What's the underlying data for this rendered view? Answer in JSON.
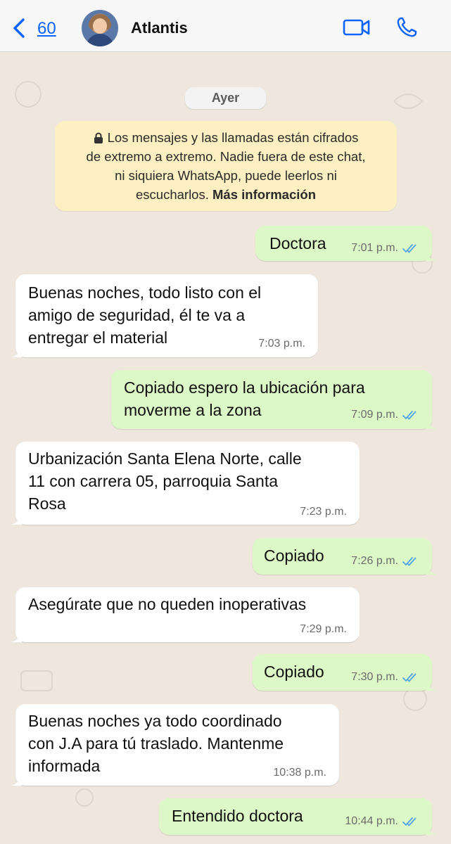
{
  "header": {
    "back_count": "60",
    "contact_name": "Atlantis",
    "icons": {
      "back": "chevron-left-icon",
      "video": "video-camera-icon",
      "phone": "phone-icon"
    },
    "accent_color": "#0a64ff"
  },
  "chat": {
    "date_chip": "Ayer",
    "encryption_notice": {
      "text": "Los mensajes y las llamadas están cifrados de extremo a extremo. Nadie fuera de este chat, ni siquiera WhatsApp, puede leerlos ni escucharlos.",
      "line1": "Los mensajes y las llamadas están cifrados",
      "line2": "de extremo a extremo. Nadie fuera de este chat,",
      "line3": "ni siquiera WhatsApp, puede leerlos ni",
      "line4_prefix": "escucharlos.",
      "link": "Más información"
    },
    "messages": [
      {
        "direction": "outgoing",
        "lines": [
          "Doctora"
        ],
        "time": "7:01 p.m.",
        "read": true
      },
      {
        "direction": "incoming",
        "lines": [
          "Buenas noches, todo listo con el",
          "amigo de seguridad, él te va a",
          "entregar el material"
        ],
        "time": "7:03 p.m."
      },
      {
        "direction": "outgoing",
        "lines": [
          "Copiado espero la ubicación para",
          "moverme a la zona"
        ],
        "time": "7:09 p.m.",
        "read": true
      },
      {
        "direction": "incoming",
        "lines": [
          "Urbanización Santa Elena Norte, calle",
          "11 con carrera 05, parroquia Santa",
          "Rosa"
        ],
        "time": "7:23 p.m."
      },
      {
        "direction": "outgoing",
        "lines": [
          "Copiado"
        ],
        "time": "7:26 p.m.",
        "read": true
      },
      {
        "direction": "incoming",
        "lines": [
          "Asegúrate que no queden inoperativas"
        ],
        "time": "7:29 p.m."
      },
      {
        "direction": "outgoing",
        "lines": [
          "Copiado"
        ],
        "time": "7:30 p.m.",
        "read": true
      },
      {
        "direction": "incoming",
        "lines": [
          "Buenas noches ya todo coordinado",
          "con J.A para tú traslado. Mantenme",
          "informada"
        ],
        "time": "10:38 p.m."
      },
      {
        "direction": "outgoing",
        "lines": [
          "Entendido doctora"
        ],
        "time": "10:44 p.m.",
        "read": true
      }
    ],
    "colors": {
      "outgoing": "#dbf8c6",
      "incoming": "#ffffff",
      "read_ticks": "#4fa3e6",
      "wallpaper": "#efe7de",
      "notice": "#fcf0c2"
    }
  }
}
